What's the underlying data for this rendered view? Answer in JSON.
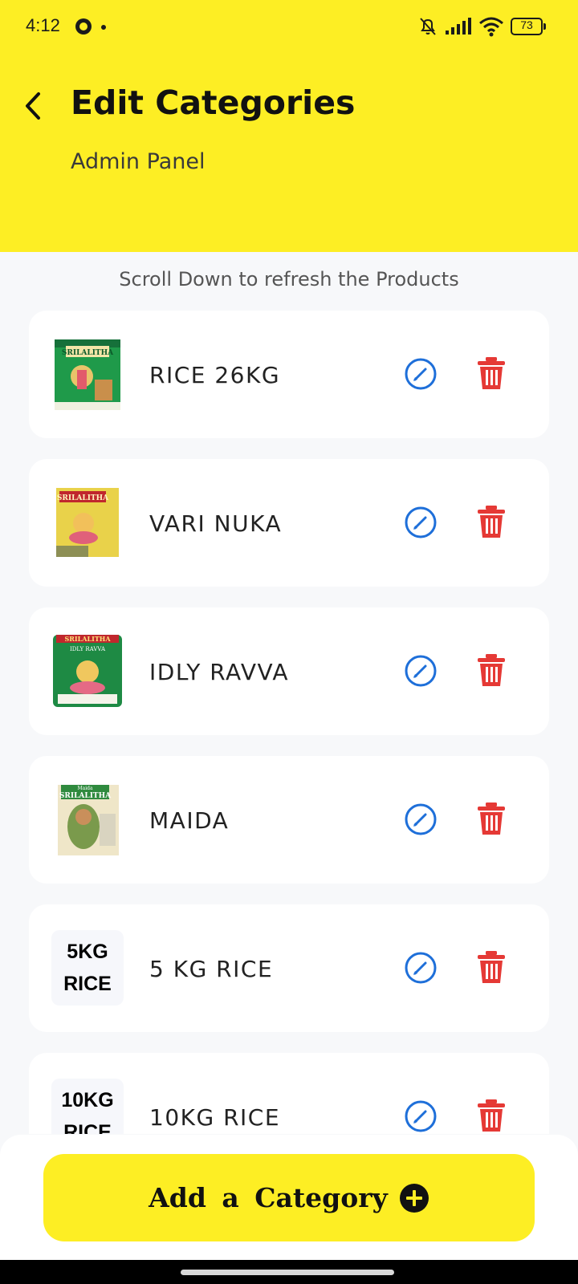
{
  "status_bar": {
    "time": "4:12",
    "battery": "73",
    "icons": [
      "app-notification-icon",
      "bell-off-icon",
      "signal-icon",
      "wifi-icon",
      "battery-icon"
    ]
  },
  "header": {
    "title": "Edit Categories",
    "subtitle": "Admin Panel",
    "background_color": "#fdee24"
  },
  "hint": "Scroll Down to refresh the Products",
  "categories": [
    {
      "name": "RICE 26KG",
      "thumb_brand": "SRILALITHA",
      "thumb_type": "image"
    },
    {
      "name": "VARI NUKA",
      "thumb_brand": "SRILALITHA",
      "thumb_type": "image"
    },
    {
      "name": "IDLY RAVVA",
      "thumb_brand": "SRILALITHA",
      "thumb_sub": "IDLY RAVVA",
      "thumb_type": "image"
    },
    {
      "name": "MAIDA",
      "thumb_brand": "SRILALITHA",
      "thumb_sub": "Maida",
      "thumb_type": "image"
    },
    {
      "name": "5 KG RICE",
      "thumb_type": "text",
      "thumb_line1": "5KG",
      "thumb_line2": "RICE"
    },
    {
      "name": "10KG RICE",
      "thumb_type": "text",
      "thumb_line1": "10KG",
      "thumb_line2": "RICE"
    }
  ],
  "colors": {
    "edit_icon": "#1e6fd9",
    "delete_icon": "#e53935",
    "accent_yellow": "#fdee24"
  },
  "add_button": {
    "label": "Add a Category",
    "icon": "plus-circle-icon"
  }
}
